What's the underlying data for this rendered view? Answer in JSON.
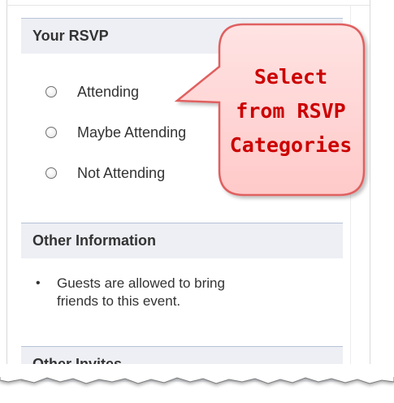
{
  "rsvp": {
    "header": "Your RSVP",
    "options": [
      "Attending",
      "Maybe Attending",
      "Not Attending"
    ]
  },
  "other_information": {
    "header": "Other Information",
    "bullet": "•",
    "note_line1": "Guests are allowed to bring",
    "note_line2": "friends to this event."
  },
  "other_invites": {
    "header": "Other Invites"
  },
  "callout": {
    "line1": "Select",
    "line2": "from RSVP",
    "line3": "Categories",
    "fill_color": "#ffd9d9",
    "border_color": "#e06060",
    "text_color": "#cc0000"
  },
  "colors": {
    "section_header_bg": "#edeff4",
    "section_border": "#b8c3d6",
    "text": "#333333"
  }
}
